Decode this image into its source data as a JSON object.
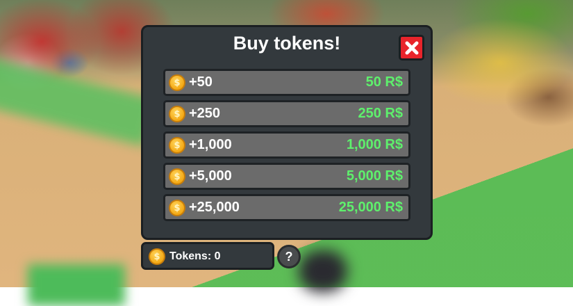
{
  "shop": {
    "title": "Buy tokens!",
    "close_icon": "close-x-icon",
    "coin_icon": "token-coin-icon",
    "coin_symbol": "$",
    "items": [
      {
        "amount": "+50",
        "price": "50 R$"
      },
      {
        "amount": "+250",
        "price": "250 R$"
      },
      {
        "amount": "+1,000",
        "price": "1,000 R$"
      },
      {
        "amount": "+5,000",
        "price": "5,000 R$"
      },
      {
        "amount": "+25,000",
        "price": "25,000 R$"
      }
    ]
  },
  "balance": {
    "label": "Tokens: 0"
  },
  "help": {
    "label": "?"
  },
  "colors": {
    "panel": "#33393d",
    "row": "#6b6b6b",
    "price": "#5ef06c",
    "close": "#e8242b",
    "coin": "#f3a814"
  }
}
